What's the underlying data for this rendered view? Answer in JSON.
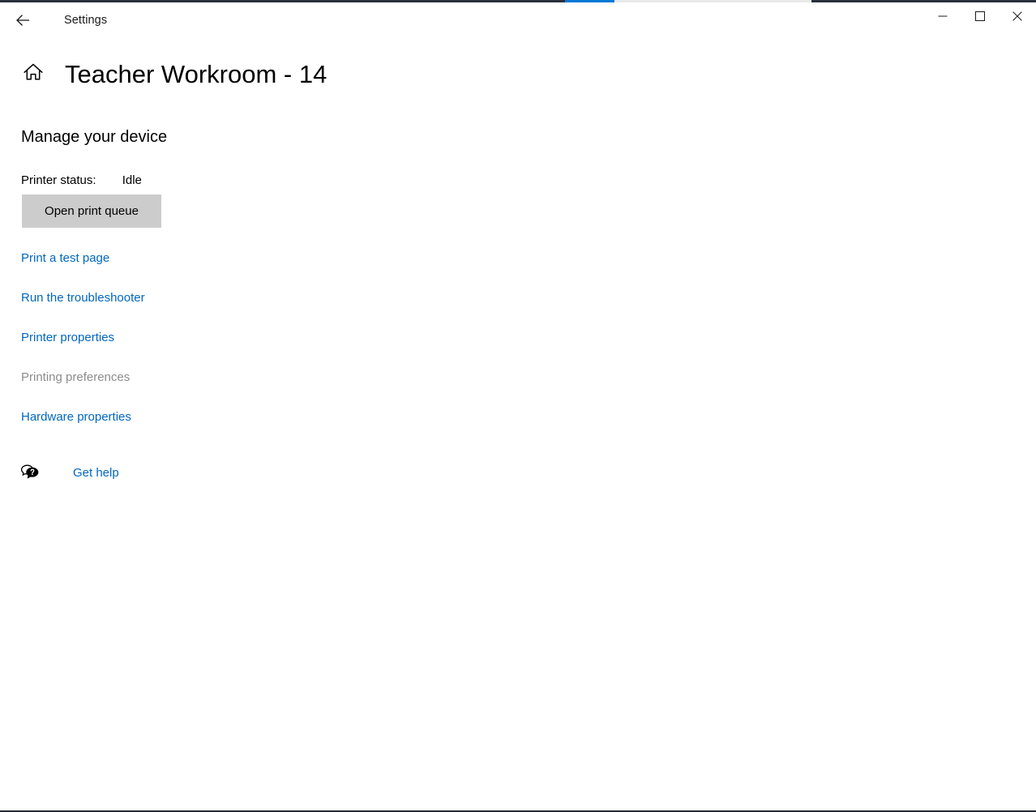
{
  "window": {
    "titlebar": {
      "back_icon": "back-arrow-icon",
      "title": "Settings",
      "minimize_icon": "minimize-icon",
      "maximize_icon": "maximize-icon",
      "close_icon": "close-icon"
    },
    "accent_color": "#0078d7",
    "border_color": "#2b303c"
  },
  "header": {
    "home_icon": "home-icon",
    "title": "Teacher Workroom - 14"
  },
  "main": {
    "section_heading": "Manage your device",
    "printer_status": {
      "label": "Printer status:",
      "value": "Idle"
    },
    "open_print_queue_label": "Open print queue",
    "links": [
      {
        "label": "Print a test page",
        "enabled": true
      },
      {
        "label": "Run the troubleshooter",
        "enabled": true
      },
      {
        "label": "Printer properties",
        "enabled": true
      },
      {
        "label": "Printing preferences",
        "enabled": false
      },
      {
        "label": "Hardware properties",
        "enabled": true
      }
    ],
    "get_help": {
      "icon": "help-bubble-icon",
      "label": "Get help"
    }
  },
  "colors": {
    "link": "#0067c0",
    "link_disabled": "#8c8c8c",
    "button_face": "#cccccc",
    "accent": "#0078d7"
  }
}
